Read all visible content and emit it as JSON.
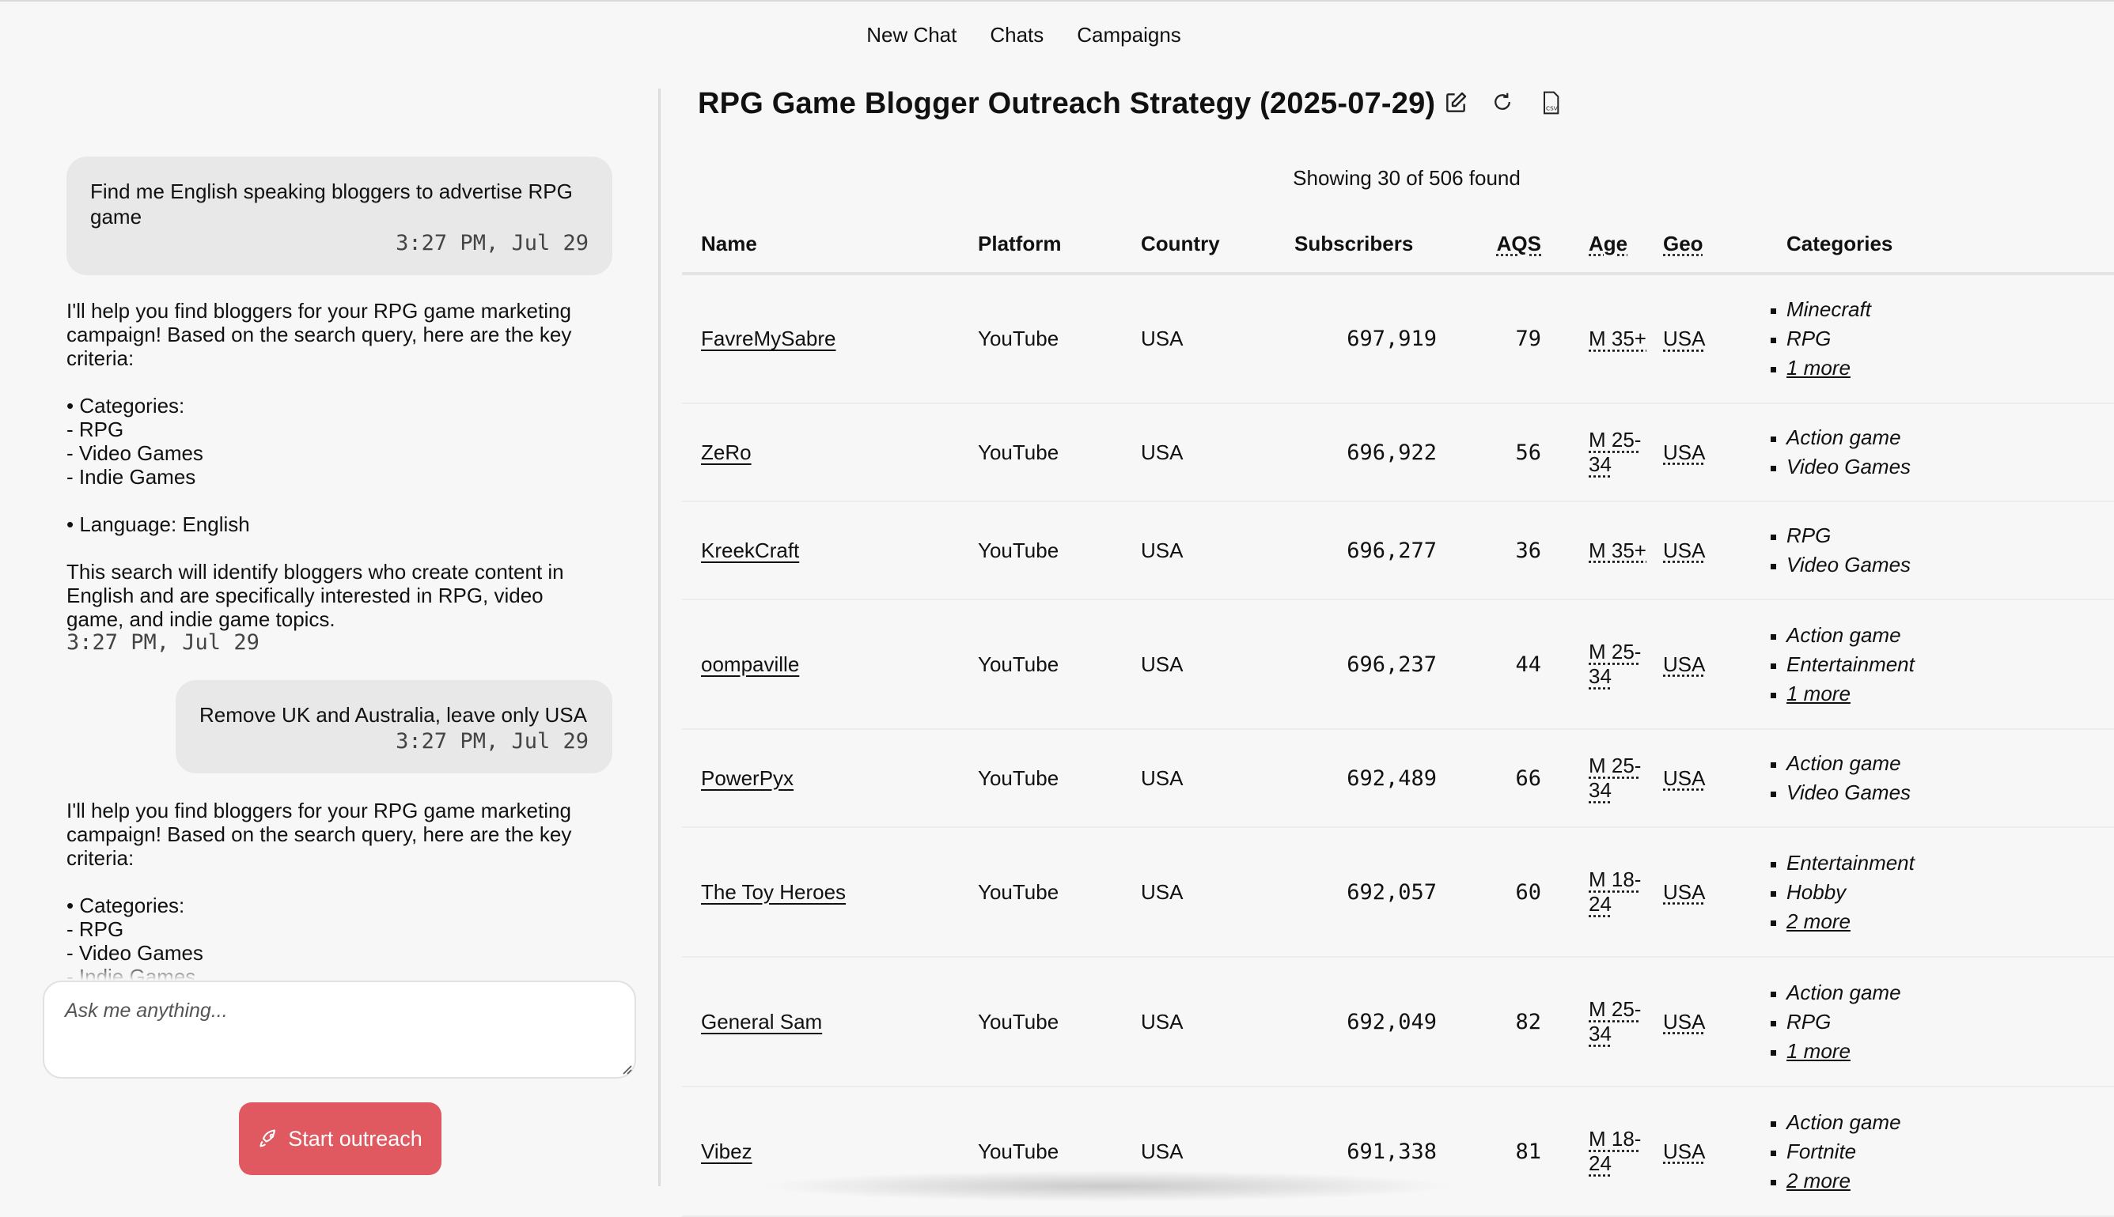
{
  "nav": {
    "items": [
      "New Chat",
      "Chats",
      "Campaigns"
    ]
  },
  "chat": {
    "messages": [
      {
        "role": "user",
        "text": "Find me English speaking bloggers to advertise RPG game",
        "time": "3:27 PM, Jul 29"
      },
      {
        "role": "assistant",
        "text": "I'll help you find bloggers for your RPG game marketing campaign! Based on the search query, here are the key criteria:\n\n• Categories:\n  - RPG\n  - Video Games\n  - Indie Games\n\n• Language: English\n\nThis search will identify bloggers who create content in English and are specifically interested in RPG, video game, and indie game topics.",
        "time": "3:27 PM, Jul 29"
      },
      {
        "role": "user",
        "text": "Remove UK and Australia, leave only USA",
        "time": "3:27 PM, Jul 29"
      },
      {
        "role": "assistant",
        "text": "I'll help you find bloggers for your RPG game marketing campaign! Based on the search query, here are the key criteria:\n\n• Categories:\n  - RPG\n  - Video Games\n  - Indie Games"
      }
    ],
    "input_placeholder": "Ask me anything...",
    "start_button": "Start outreach"
  },
  "results": {
    "title": "RPG Game Blogger Outreach Strategy (2025-07-29)",
    "summary": "Showing 30 of 506 found",
    "columns": [
      "Name",
      "Platform",
      "Country",
      "Subscribers",
      "AQS",
      "Age",
      "Geo",
      "Categories"
    ],
    "rows": [
      {
        "name": "FavreMySabre",
        "platform": "YouTube",
        "country": "USA",
        "subscribers": "697,919",
        "aqs": "79",
        "age": "M 35+",
        "geo": "USA",
        "categories": [
          "Minecraft",
          "RPG"
        ],
        "more": "1 more"
      },
      {
        "name": "ZeRo",
        "platform": "YouTube",
        "country": "USA",
        "subscribers": "696,922",
        "aqs": "56",
        "age": "M 25-34",
        "geo": "USA",
        "categories": [
          "Action game",
          "Video Games"
        ],
        "more": ""
      },
      {
        "name": "KreekCraft",
        "platform": "YouTube",
        "country": "USA",
        "subscribers": "696,277",
        "aqs": "36",
        "age": "M 35+",
        "geo": "USA",
        "categories": [
          "RPG",
          "Video Games"
        ],
        "more": ""
      },
      {
        "name": "oompaville",
        "platform": "YouTube",
        "country": "USA",
        "subscribers": "696,237",
        "aqs": "44",
        "age": "M 25-34",
        "geo": "USA",
        "categories": [
          "Action game",
          "Entertainment"
        ],
        "more": "1 more"
      },
      {
        "name": "PowerPyx",
        "platform": "YouTube",
        "country": "USA",
        "subscribers": "692,489",
        "aqs": "66",
        "age": "M 25-34",
        "geo": "USA",
        "categories": [
          "Action game",
          "Video Games"
        ],
        "more": ""
      },
      {
        "name": "The Toy Heroes",
        "platform": "YouTube",
        "country": "USA",
        "subscribers": "692,057",
        "aqs": "60",
        "age": "M 18-24",
        "geo": "USA",
        "categories": [
          "Entertainment",
          "Hobby"
        ],
        "more": "2 more"
      },
      {
        "name": "General Sam",
        "platform": "YouTube",
        "country": "USA",
        "subscribers": "692,049",
        "aqs": "82",
        "age": "M 25-34",
        "geo": "USA",
        "categories": [
          "Action game",
          "RPG"
        ],
        "more": "1 more"
      },
      {
        "name": "Vibez",
        "platform": "YouTube",
        "country": "USA",
        "subscribers": "691,338",
        "aqs": "81",
        "age": "M 18-24",
        "geo": "USA",
        "categories": [
          "Action game",
          "Fortnite"
        ],
        "more": "2 more"
      }
    ]
  },
  "colors": {
    "accent": "#e05860",
    "background": "#f7f7f7",
    "bubble": "#e8e8e8"
  }
}
